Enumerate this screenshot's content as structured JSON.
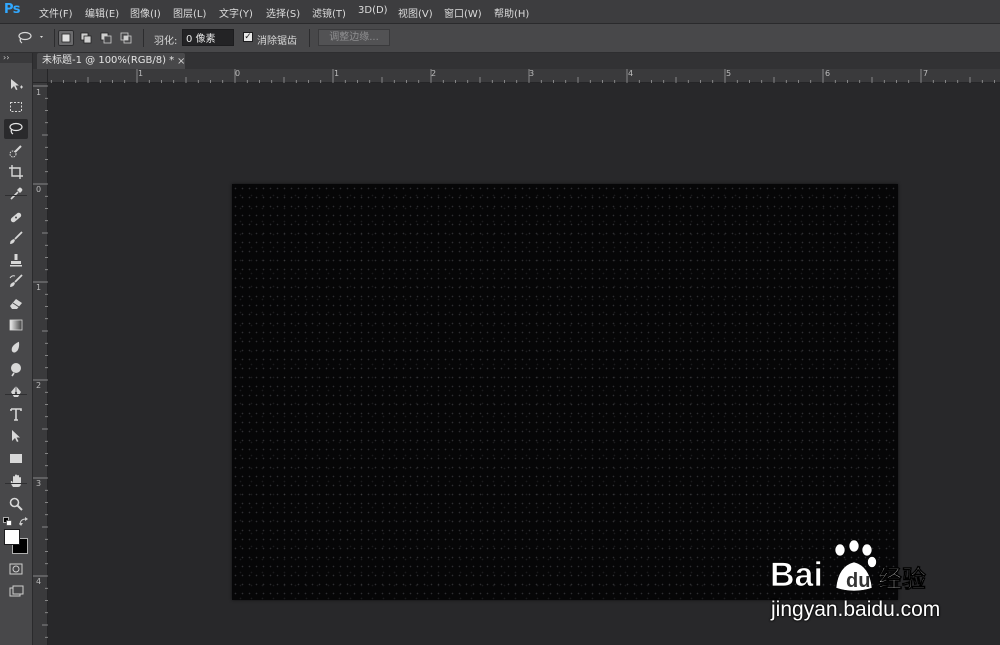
{
  "app": {
    "logo": "Ps"
  },
  "menu": [
    {
      "label": "文件(F)"
    },
    {
      "label": "编辑(E)"
    },
    {
      "label": "图像(I)"
    },
    {
      "label": "图层(L)"
    },
    {
      "label": "文字(Y)"
    },
    {
      "label": "选择(S)"
    },
    {
      "label": "滤镜(T)"
    },
    {
      "label": "3D(D)"
    },
    {
      "label": "视图(V)"
    },
    {
      "label": "窗口(W)"
    },
    {
      "label": "帮助(H)"
    }
  ],
  "options": {
    "tool_icon": "lasso-icon",
    "feather_label": "羽化:",
    "feather_value": "0 像素",
    "antialias_label": "消除锯齿",
    "antialias_checked": true,
    "refine_edge_label": "调整边缘..."
  },
  "document": {
    "tab_title": "未标题-1 @ 100%(RGB/8) *",
    "close_glyph": "×"
  },
  "rulers": {
    "horizontal": [
      "1",
      "0",
      "1",
      "2",
      "3",
      "4",
      "5",
      "6",
      "7"
    ],
    "vertical": [
      "1",
      "0",
      "1",
      "2",
      "3",
      "4"
    ]
  },
  "toolbar": {
    "collapse_glyph": "››",
    "tools": [
      "move-tool-icon",
      "marquee-tool-icon",
      "lasso-tool-icon",
      "quick-selection-tool-icon",
      "crop-tool-icon",
      "eyedropper-tool-icon",
      "healing-brush-tool-icon",
      "brush-tool-icon",
      "clone-stamp-tool-icon",
      "history-brush-tool-icon",
      "eraser-tool-icon",
      "gradient-tool-icon",
      "blur-tool-icon",
      "dodge-tool-icon",
      "pen-tool-icon",
      "type-tool-icon",
      "path-selection-tool-icon",
      "rectangle-tool-icon",
      "hand-tool-icon",
      "zoom-tool-icon"
    ],
    "active_tool": "lasso-tool-icon",
    "foreground_color": "#ffffff",
    "background_color": "#000000"
  },
  "canvas": {
    "background": "#060607"
  },
  "watermark": {
    "logo_text_left": "Bai",
    "logo_text_right": "经验",
    "url": "jingyan.baidu.com"
  }
}
